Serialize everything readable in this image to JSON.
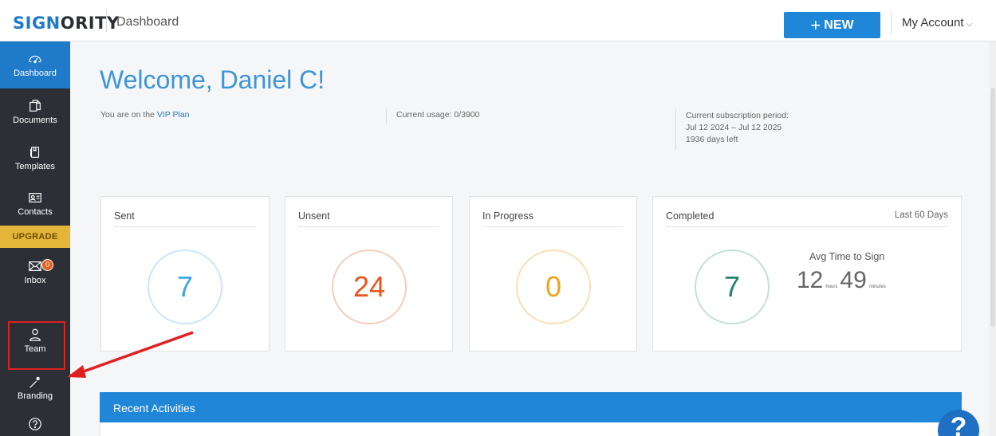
{
  "app": {
    "logo_part1": "SIGN",
    "logo_part2": "ORITY",
    "page_title": "Dashboard",
    "new_button_label": "NEW",
    "new_button_plus": "+",
    "account_label": "My Account",
    "account_chevron": "⌵"
  },
  "sidebar": {
    "items": [
      {
        "label": "Dashboard",
        "icon": "dashboard-icon",
        "active": true
      },
      {
        "label": "Documents",
        "icon": "documents-icon"
      },
      {
        "label": "Templates",
        "icon": "templates-icon"
      },
      {
        "label": "Contacts",
        "icon": "contacts-icon"
      },
      {
        "label": "Inbox",
        "icon": "inbox-icon",
        "badge": "0"
      },
      {
        "label": "Team",
        "icon": "team-icon"
      },
      {
        "label": "Branding",
        "icon": "branding-icon"
      },
      {
        "label": "",
        "icon": "help-icon"
      }
    ],
    "upgrade_label": "UPGRADE"
  },
  "welcome": {
    "heading": "Welcome, Daniel C!",
    "plan_prefix": "You are on the ",
    "plan_name": "VIP Plan",
    "usage": "Current usage: 0/3900",
    "subscription_label": "Current subscription period:",
    "subscription_range": "Jul 12 2024 – Jul 12 2025",
    "days_left": "1936 days left"
  },
  "stats": {
    "sent": {
      "label": "Sent",
      "value": "7",
      "color": "#3aa8e0",
      "ring": "#cbe6f6"
    },
    "unsent": {
      "label": "Unsent",
      "value": "24",
      "color": "#e8561e",
      "ring": "#f6cdbb"
    },
    "in_progress": {
      "label": "In Progress",
      "value": "0",
      "color": "#f0a41c",
      "ring": "#f7e0b3"
    },
    "completed": {
      "label": "Completed",
      "value": "7",
      "color": "#23836f",
      "ring": "#c3e1d9",
      "range": "Last 60 Days",
      "avg_label": "Avg Time to Sign",
      "avg_hours": "12",
      "hours_unit": "hours",
      "avg_minutes": "49",
      "minutes_unit": "minutes"
    }
  },
  "recent": {
    "title": "Recent Activities"
  },
  "help_fab": {
    "label": "?"
  },
  "colors": {
    "brand_blue": "#1f7ac9",
    "sidebar_bg": "#2c3036",
    "upgrade": "#e5b53a",
    "annotation_red": "#e02020"
  }
}
